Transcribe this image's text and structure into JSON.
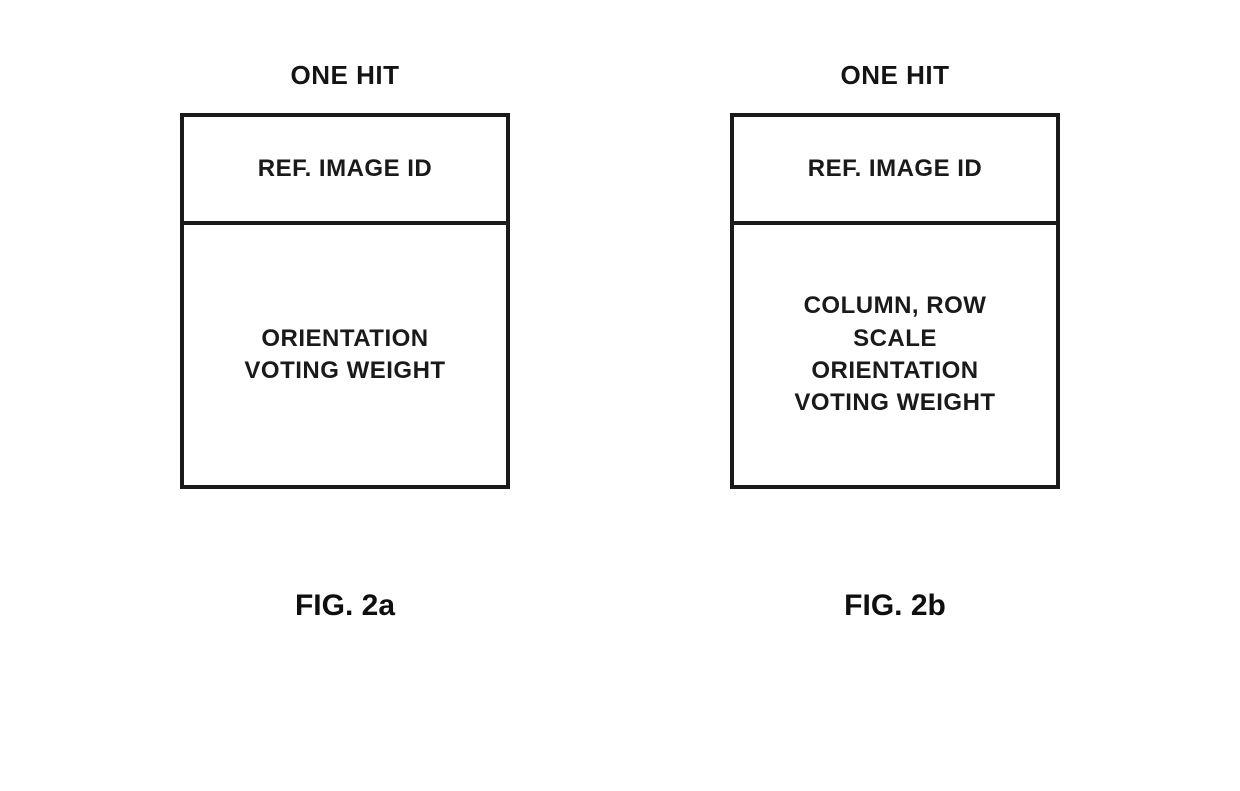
{
  "figures": {
    "left": {
      "title": "ONE HIT",
      "topCell": "REF. IMAGE ID",
      "bottomLine1": "ORIENTATION",
      "bottomLine2": "VOTING WEIGHT",
      "caption": "FIG. 2a"
    },
    "right": {
      "title": "ONE HIT",
      "topCell": "REF. IMAGE ID",
      "bottomLine1": "COLUMN, ROW",
      "bottomLine2": "SCALE",
      "bottomLine3": "ORIENTATION",
      "bottomLine4": "VOTING WEIGHT",
      "caption": "FIG. 2b"
    }
  }
}
